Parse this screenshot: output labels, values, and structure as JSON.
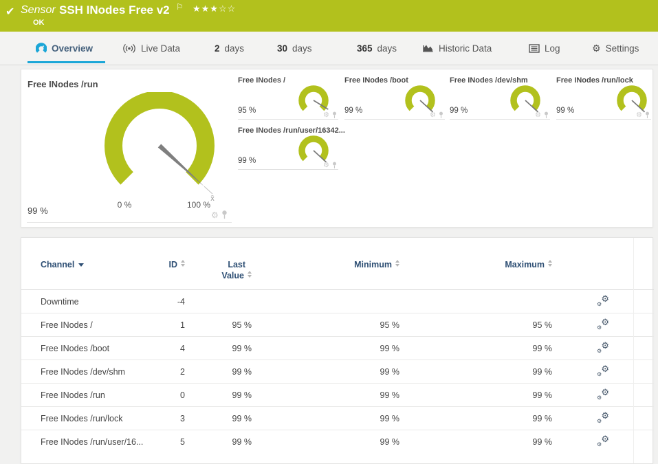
{
  "colors": {
    "status_ok_green": "#b2c11d",
    "active_tab_blue": "#1ba6d7",
    "table_header_navy": "#2e4f74"
  },
  "header": {
    "check_icon": "✔",
    "type_label": "Sensor",
    "title": "SSH INodes Free v2",
    "flag_icon": "⚐",
    "stars": "★★★☆☆",
    "stars_filled": 3,
    "stars_total": 5,
    "status": "OK"
  },
  "tabs": [
    {
      "label": "Overview",
      "icon": "gauge-icon",
      "active": true
    },
    {
      "label": "Live Data",
      "icon": "broadcast-icon",
      "active": false
    },
    {
      "num": "2",
      "label": "days",
      "active": false
    },
    {
      "num": "30",
      "label": "days",
      "active": false
    },
    {
      "num": "365",
      "label": "days",
      "active": false
    },
    {
      "label": "Historic Data",
      "icon": "area-chart-icon",
      "active": false
    },
    {
      "label": "Log",
      "icon": "list-icon",
      "active": false
    },
    {
      "label": "Settings",
      "icon": "gear-icon",
      "active": false
    }
  ],
  "gauges": {
    "main": {
      "title": "Free INodes /run",
      "value": "99 %",
      "percent": 99,
      "scale_min": "0 %",
      "scale_max": "100 %",
      "avg_marker": "x̄"
    },
    "small": [
      {
        "title": "Free INodes /",
        "value": "95 %",
        "percent": 95
      },
      {
        "title": "Free INodes /boot",
        "value": "99 %",
        "percent": 99
      },
      {
        "title": "Free INodes /dev/shm",
        "value": "99 %",
        "percent": 99
      },
      {
        "title": "Free INodes /run/lock",
        "value": "99 %",
        "percent": 99
      },
      {
        "title": "Free INodes /run/user/16342...",
        "value": "99 %",
        "percent": 99
      }
    ]
  },
  "table": {
    "headers": {
      "channel": "Channel",
      "id": "ID",
      "last_line1": "Last",
      "last_line2": "Value",
      "minimum": "Minimum",
      "maximum": "Maximum"
    },
    "rows": [
      {
        "channel": "Downtime",
        "id": "-4",
        "last": "",
        "min": "",
        "max": ""
      },
      {
        "channel": "Free INodes /",
        "id": "1",
        "last": "95 %",
        "min": "95 %",
        "max": "95 %"
      },
      {
        "channel": "Free INodes /boot",
        "id": "4",
        "last": "99 %",
        "min": "99 %",
        "max": "99 %"
      },
      {
        "channel": "Free INodes /dev/shm",
        "id": "2",
        "last": "99 %",
        "min": "99 %",
        "max": "99 %"
      },
      {
        "channel": "Free INodes /run",
        "id": "0",
        "last": "99 %",
        "min": "99 %",
        "max": "99 %"
      },
      {
        "channel": "Free INodes /run/lock",
        "id": "3",
        "last": "99 %",
        "min": "99 %",
        "max": "99 %"
      },
      {
        "channel": "Free INodes /run/user/16...",
        "id": "5",
        "last": "99 %",
        "min": "99 %",
        "max": "99 %"
      }
    ]
  }
}
